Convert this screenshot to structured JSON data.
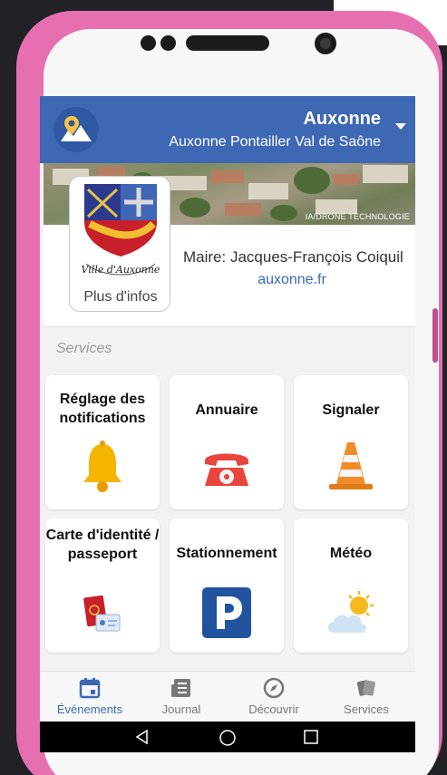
{
  "header": {
    "town": "Auxonne",
    "subtitle": "Auxonne Pontailler Val de Saône",
    "logo_icon": "map-pin-landscape-icon",
    "dropdown_icon": "chevron-down-icon"
  },
  "banner": {
    "credit": "IA/DRONE TECHNOLOGIE"
  },
  "info": {
    "crest_text": "Ville d'Auxonne",
    "more_info": "Plus d'infos",
    "mayor": "Maire: Jacques-François Coiquil",
    "website": "auxonne.fr"
  },
  "services": {
    "section_label": "Services",
    "tiles": [
      {
        "label": "Réglage des notifications",
        "icon": "bell-icon"
      },
      {
        "label": "Annuaire",
        "icon": "telephone-icon"
      },
      {
        "label": "Signaler",
        "icon": "traffic-cone-icon"
      },
      {
        "label": "Carte d'identité / passeport",
        "icon": "passport-id-card-icon"
      },
      {
        "label": "Stationnement",
        "icon": "parking-icon"
      },
      {
        "label": "Météo",
        "icon": "sun-cloud-icon"
      }
    ]
  },
  "nav": {
    "items": [
      {
        "label": "Événements",
        "icon": "calendar-icon",
        "active": true
      },
      {
        "label": "Journal",
        "icon": "newspaper-icon",
        "active": false
      },
      {
        "label": "Découvrir",
        "icon": "compass-icon",
        "active": false
      },
      {
        "label": "Services",
        "icon": "cards-icon",
        "active": false
      }
    ]
  },
  "colors": {
    "primary": "#3e68b3",
    "phone_case": "#e66fb0",
    "background": "#222226"
  }
}
